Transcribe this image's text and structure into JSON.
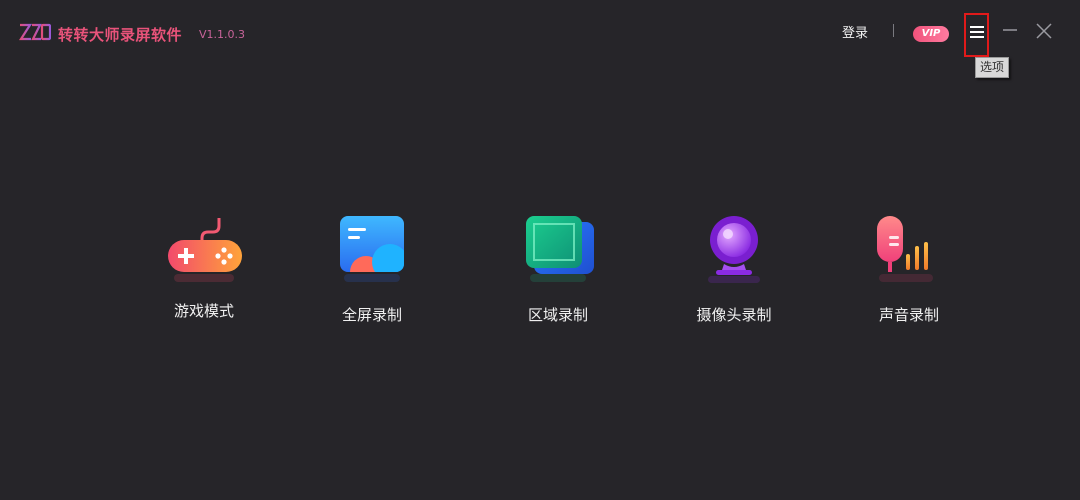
{
  "app": {
    "title": "转转大师录屏软件",
    "version": "V1.1.0.3"
  },
  "header": {
    "login_label": "登录",
    "vip_label": "VIP",
    "menu_tooltip": "选项"
  },
  "modes": [
    {
      "label": "游戏模式",
      "icon": "gamepad-icon"
    },
    {
      "label": "全屏录制",
      "icon": "fullscreen-icon"
    },
    {
      "label": "区域录制",
      "icon": "region-icon"
    },
    {
      "label": "摄像头录制",
      "icon": "webcam-icon"
    },
    {
      "label": "声音录制",
      "icon": "microphone-icon"
    }
  ],
  "colors": {
    "background": "#262529",
    "brand": "#e8537a",
    "vip": "#f0537b",
    "highlight_box": "#e11a1a"
  }
}
